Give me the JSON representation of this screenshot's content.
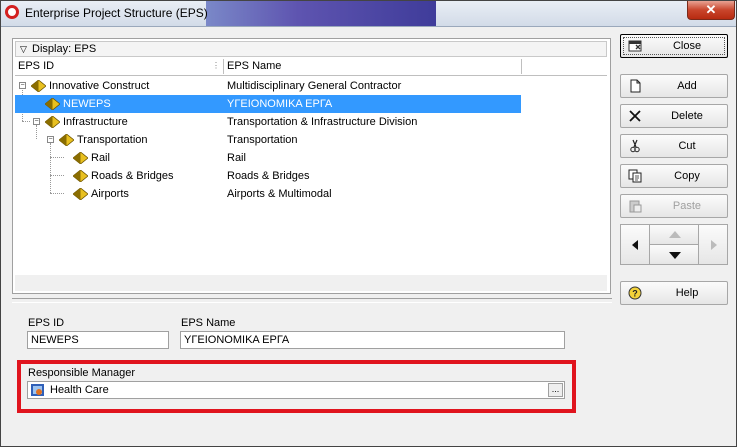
{
  "window": {
    "title": "Enterprise Project Structure (EPS)"
  },
  "tree": {
    "display_label": "Display: EPS",
    "columns": {
      "eps_id": "EPS ID",
      "eps_name": "EPS Name"
    },
    "rows": [
      {
        "id": "Innovative Construct",
        "name": "Multidisciplinary General Contractor",
        "level": 0,
        "expander": "−",
        "selected": false
      },
      {
        "id": "NEWEPS",
        "name": "ΥΓΕΙΟΝΟΜΙΚΑ ΕΡΓΑ",
        "level": 1,
        "expander": "",
        "selected": true
      },
      {
        "id": "Infrastructure",
        "name": "Transportation & Infrastructure Division",
        "level": 1,
        "expander": "−",
        "selected": false
      },
      {
        "id": "Transportation",
        "name": "Transportation",
        "level": 2,
        "expander": "−",
        "selected": false
      },
      {
        "id": "Rail",
        "name": "Rail",
        "level": 3,
        "expander": "",
        "selected": false
      },
      {
        "id": "Roads & Bridges",
        "name": "Roads & Bridges",
        "level": 3,
        "expander": "",
        "selected": false
      },
      {
        "id": "Airports",
        "name": "Airports & Multimodal",
        "level": 3,
        "expander": "",
        "selected": false
      }
    ]
  },
  "details": {
    "eps_id_label": "EPS ID",
    "eps_id_value": "NEWEPS",
    "eps_name_label": "EPS Name",
    "eps_name_value": "ΥΓΕΙΟΝΟΜΙΚΑ ΕΡΓΑ",
    "manager_label": "Responsible Manager",
    "manager_value": "Health Care",
    "ellipsis": "..."
  },
  "buttons": {
    "close": "Close",
    "add": "Add",
    "delete": "Delete",
    "cut": "Cut",
    "copy": "Copy",
    "paste": "Paste",
    "help": "Help"
  },
  "colors": {
    "selection": "#3399ff",
    "highlight_box": "#e0141e",
    "eps_icon": "#e8c020"
  }
}
